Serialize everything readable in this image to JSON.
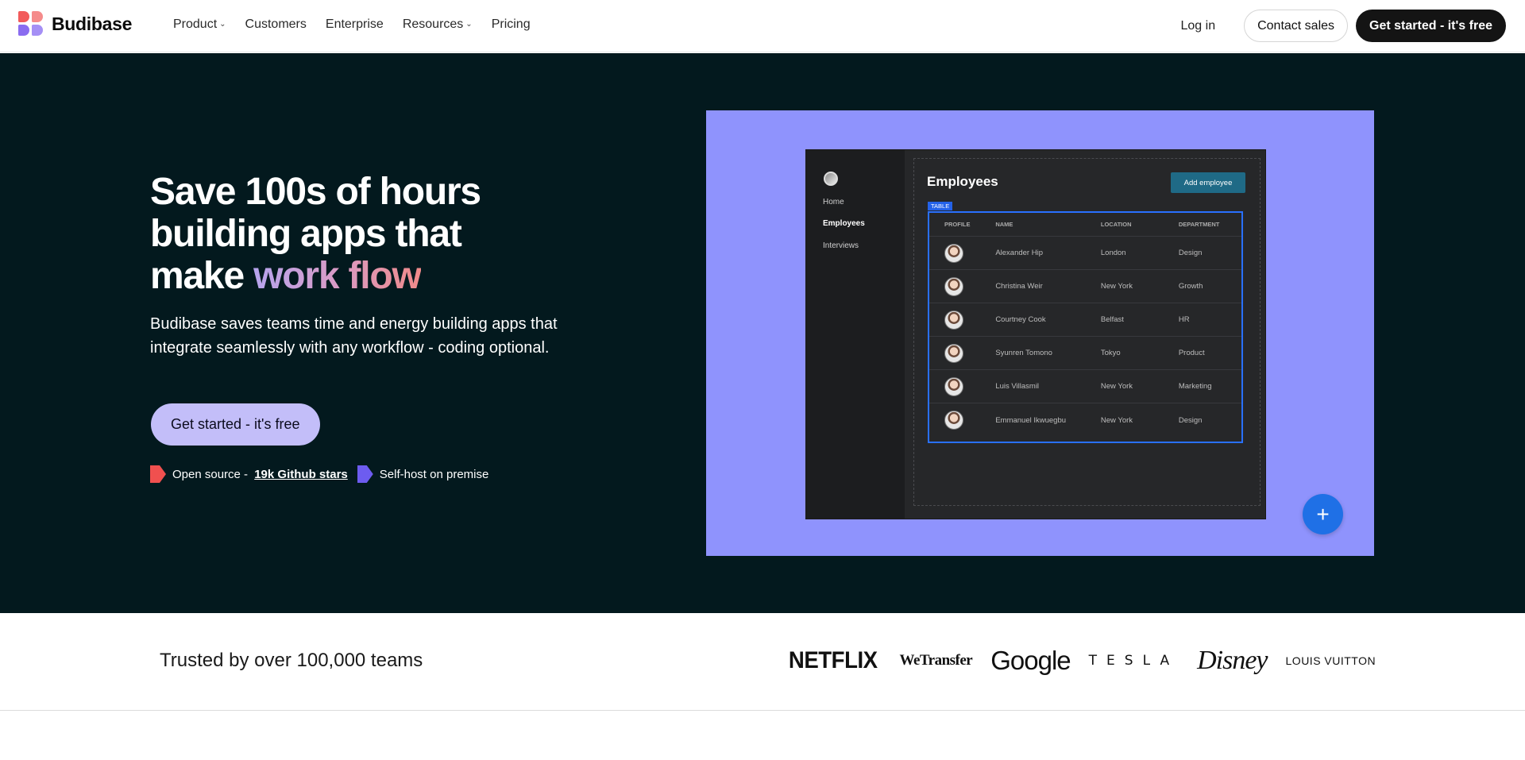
{
  "brand": {
    "name": "Budibase"
  },
  "nav": {
    "links": [
      {
        "label": "Product",
        "has_dropdown": true
      },
      {
        "label": "Customers",
        "has_dropdown": false
      },
      {
        "label": "Enterprise",
        "has_dropdown": false
      },
      {
        "label": "Resources",
        "has_dropdown": true
      },
      {
        "label": "Pricing",
        "has_dropdown": false
      }
    ],
    "login": "Log in",
    "contact_sales": "Contact sales",
    "get_started": "Get started - it's free"
  },
  "hero": {
    "title_line1": "Save 100s of hours",
    "title_line2": "building apps that",
    "title_line3_prefix": "make ",
    "title_highlight": "work flow",
    "subtitle": "Budibase saves teams time and energy building apps that integrate seamlessly with any workflow - coding optional.",
    "cta": "Get started - it's free",
    "badge_open_source": "Open source - ",
    "badge_github": "19k Github stars",
    "badge_self_host": "Self-host on premise"
  },
  "app_preview": {
    "sidebar": [
      "Home",
      "Employees",
      "Interviews"
    ],
    "active_sidebar": "Employees",
    "title": "Employees",
    "add_button": "Add employee",
    "table_tag": "TABLE",
    "columns": [
      "PROFILE",
      "NAME",
      "LOCATION",
      "DEPARTMENT"
    ],
    "rows": [
      {
        "name": "Alexander Hip",
        "location": "London",
        "department": "Design"
      },
      {
        "name": "Christina Weir",
        "location": "New York",
        "department": "Growth"
      },
      {
        "name": "Courtney Cook",
        "location": "Belfast",
        "department": "HR"
      },
      {
        "name": "Syunren Tomono",
        "location": "Tokyo",
        "department": "Product"
      },
      {
        "name": "Luis Villasmil",
        "location": "New York",
        "department": "Marketing"
      },
      {
        "name": "Emmanuel Ikwuegbu",
        "location": "New York",
        "department": "Design"
      }
    ],
    "fab_icon": "plus-icon"
  },
  "trust": {
    "text": "Trusted by over 100,000 teams",
    "logos": [
      "NETFLIX",
      "WeTransfer",
      "Google",
      "TESLA",
      "Disney",
      "LOUIS VUITTON"
    ]
  },
  "colors": {
    "hero_bg": "#03191e",
    "preview_bg": "#8f93fd",
    "cta_bg": "#c3bef9",
    "dark_button": "#141414",
    "accent_blue": "#1f70e6"
  }
}
